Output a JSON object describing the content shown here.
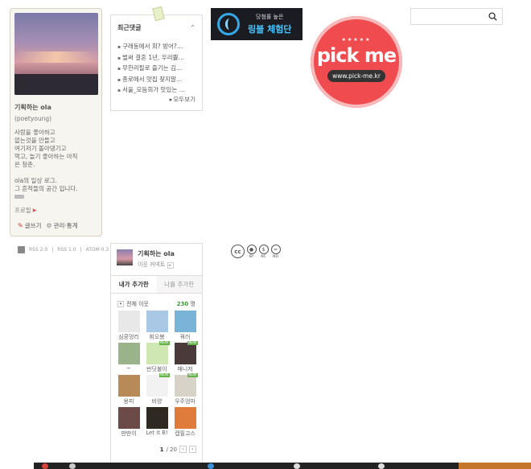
{
  "profile": {
    "name": "기획하는 ola",
    "id": "(poetyoung)",
    "desc": [
      "사람을 좋아하고",
      "없는것을 만들고",
      "여기저기 돌아댕기고",
      "먹고, 놀기 좋아하는 아직",
      "은 청춘.",
      "",
      "ola의 일상 로그.",
      "그 흔적들의 공간 입니다."
    ],
    "profile_link": "프로필",
    "write": "글쓰기",
    "manage": "관리·통계"
  },
  "comments": {
    "title": "최근댓글",
    "items": [
      "구래동에서 회? 방어?…",
      "벌써 결혼 1년, 우리쁠…",
      "무한리필로 즐기는 김…",
      "종로에서 맛집 찾지말…",
      "서울_모듬회가 맛있는 …"
    ],
    "more": "모두보기"
  },
  "ad_dark": {
    "line1": "당첨률 높은",
    "line2": "링블 체험단"
  },
  "ad_pickme": {
    "word": "pick me",
    "url": "www.pick-me.kr"
  },
  "search": {
    "value": ""
  },
  "rss": [
    "RSS 2.0",
    "RSS 1.0",
    "ATOM 0.3"
  ],
  "cc": {
    "labels": [
      "BY",
      "NC",
      "ND"
    ]
  },
  "neighbors": {
    "title": "기획하는 ola",
    "sub": "이웃 커넥트",
    "tabs": [
      "내가 추가한",
      "나를 추가한"
    ],
    "filter": "전체 이웃",
    "count": "230",
    "unit": "명",
    "new_badge": "NEW",
    "items": [
      {
        "name": "심쿵멍리",
        "color": "#e8e8e8"
      },
      {
        "name": "휘오봉",
        "color": "#a9c8e6"
      },
      {
        "name": "꿔러",
        "color": "#7ab3d8"
      },
      {
        "name": "~",
        "color": "#9bb38a"
      },
      {
        "name": "반딧불이",
        "color": "#cfe7b3"
      },
      {
        "name": "매니저",
        "color": "#4a3a3a"
      },
      {
        "name": "용피",
        "color": "#b88a58"
      },
      {
        "name": "비양",
        "color": "#f2f2f2"
      },
      {
        "name": "우주엄마",
        "color": "#d8d3c8"
      },
      {
        "name": "딴딴이",
        "color": "#6b4a48"
      },
      {
        "name": "Let it B!",
        "color": "#2e2a22"
      },
      {
        "name": "캡필고스",
        "color": "#e07c3a"
      }
    ],
    "page": "1",
    "total": "/ 20"
  }
}
